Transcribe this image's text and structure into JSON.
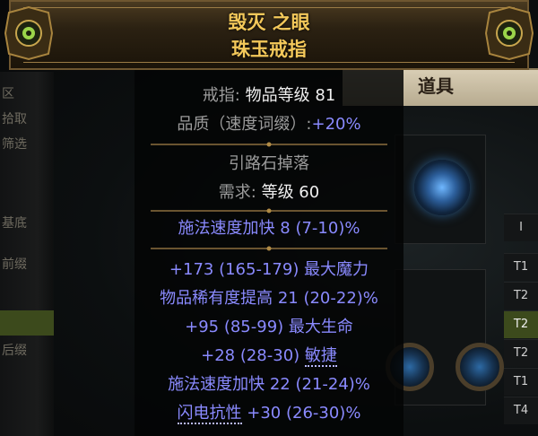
{
  "background": {
    "left_labels": [
      "区",
      "拾取",
      "筛选"
    ],
    "left_nav": [
      "基底",
      "前缀",
      "后缀"
    ],
    "inventory_title": "道具",
    "tiers": [
      "I",
      "T1",
      "T2",
      "T2",
      "T2",
      "T1",
      "T4"
    ],
    "active_tier_index": 2
  },
  "item": {
    "name": "毁灭 之眼",
    "base_type": "珠玉戒指",
    "class_label": "戒指:",
    "item_level_label": "物品等级",
    "item_level": "81",
    "quality_label": "品质（速度词缀）:",
    "quality_value": "+20%",
    "drop_info": "引路石掉落",
    "requirement_label": "需求:",
    "requirement_value": "等级 60",
    "implicit": "施法速度加快 8 (7-10)%",
    "explicit_mods": [
      {
        "pre": "+173 (165-179) 最大魔力",
        "dotted": "",
        "post": ""
      },
      {
        "pre": "物品稀有度提高 21 (20-22)%",
        "dotted": "",
        "post": ""
      },
      {
        "pre": "+95 (85-99) 最大生命",
        "dotted": "",
        "post": ""
      },
      {
        "pre": "+28 (28-30) ",
        "dotted": "敏捷",
        "post": ""
      },
      {
        "pre": "施法速度加快 22 (21-24)%",
        "dotted": "",
        "post": ""
      },
      {
        "pre": "",
        "dotted": "闪电抗性",
        "post": " +30 (26-30)%"
      }
    ]
  },
  "colors": {
    "name_gold": "#f3c85a",
    "magic_blue": "#8a8aff",
    "property_grey": "#9c9c9c"
  }
}
